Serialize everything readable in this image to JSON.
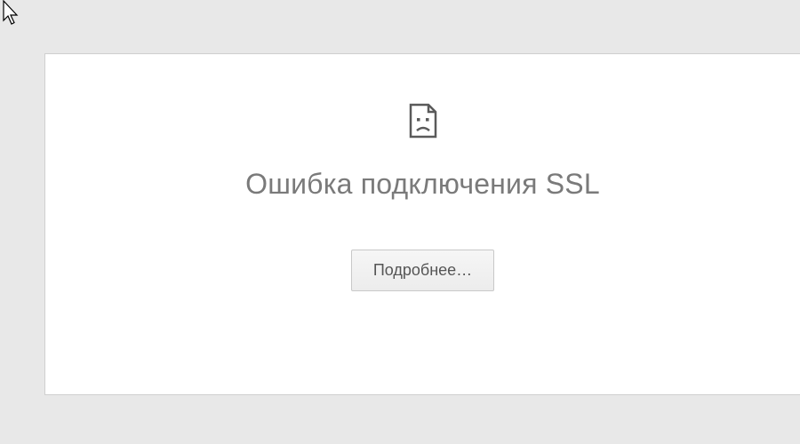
{
  "error": {
    "title": "Ошибка подключения SSL",
    "details_button_label": "Подробнее…"
  }
}
